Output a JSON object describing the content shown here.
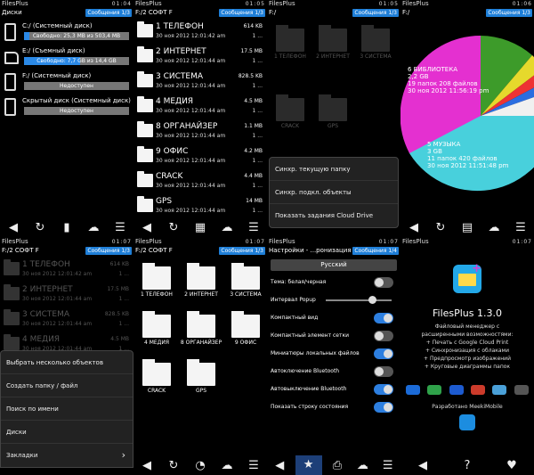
{
  "p1": {
    "status_left": "FilesPlus",
    "status_time": "01:04",
    "title": "Диски",
    "notif": "Сообщения 1/3",
    "drives": [
      {
        "name": "C:/ (Системный диск)",
        "bar": "Свободно: 25,3 MB из 503,4 MB",
        "fill": 0.05,
        "type": "phone"
      },
      {
        "name": "E:/ (Съемный диск)",
        "bar": "Свободно: 7,7 GB из 14,4 GB",
        "fill": 0.53,
        "type": "sd"
      },
      {
        "name": "F:/ (Системный диск)",
        "bar": "Недоступен",
        "fill": 0,
        "type": "phone"
      },
      {
        "name": "Скрытый диск (Системный диск)",
        "bar": "Недоступен",
        "fill": 0,
        "type": "phone"
      }
    ]
  },
  "p2": {
    "status_left": "FilesPlus",
    "status_time": "01:05",
    "title": "F:/2 СОФТ F",
    "notif": "Сообщения 1/3",
    "files": [
      {
        "name": "1 ТЕЛЕФОН",
        "size": "614 KB",
        "date": "30 ноя 2012 12:01:42 am",
        "size2": "1 ..."
      },
      {
        "name": "2 ИНТЕРНЕТ",
        "size": "17.5 MB",
        "date": "30 ноя 2012 12:01:44 am",
        "size2": "1 ..."
      },
      {
        "name": "3 СИСТЕМА",
        "size": "828.5 KB",
        "date": "30 ноя 2012 12:01:44 am",
        "size2": "1 ..."
      },
      {
        "name": "4 МЕДИЯ",
        "size": "4.5 MB",
        "date": "30 ноя 2012 12:01:44 am",
        "size2": "1 ..."
      },
      {
        "name": "8 ОРГАНАЙЗЕР",
        "size": "1.1 MB",
        "date": "30 ноя 2012 12:01:44 am",
        "size2": "1 ..."
      },
      {
        "name": "9 ОФИС",
        "size": "4.2 MB",
        "date": "30 ноя 2012 12:01:44 am",
        "size2": "1 ..."
      },
      {
        "name": "CRACK",
        "size": "4.4 MB",
        "date": "30 ноя 2012 12:01:44 am",
        "size2": "1 ..."
      },
      {
        "name": "GPS",
        "size": "14 MB",
        "date": "30 ноя 2012 12:01:44 am",
        "size2": "1 ..."
      }
    ]
  },
  "p3": {
    "status_left": "FilesPlus",
    "status_time": "01:05",
    "title": "F:/",
    "notif": "Сообщения 1/3",
    "folders": [
      "1 ТЕЛЕФОН",
      "2 ИНТЕРНЕТ",
      "3 СИСТЕМА",
      "CRACK",
      "GPS"
    ],
    "menu": [
      "Синхр. текущую папку",
      "Синхр. подкл. объекты",
      "Показать задания Cloud Drive"
    ]
  },
  "p4": {
    "status_left": "FilesPlus",
    "status_time": "01:06",
    "title": "F:/",
    "notif": "Сообщения 1/3",
    "lib": [
      "6 БИБЛИОТЕКА",
      "2,2 GB",
      "19 папок 208 файлов",
      "30 ноя 2012 11:56:19 pm"
    ],
    "music": [
      "5 МУЗЫКА",
      "3 GB",
      "11 папок 420 файлов",
      "30 ноя 2012 11:51:48 pm"
    ]
  },
  "p5": {
    "status_left": "FilesPlus",
    "status_time": "01:07",
    "title": "F:/2 СОФТ F",
    "notif": "Сообщения 1/3",
    "files": [
      {
        "name": "1 ТЕЛЕФОН",
        "size": "614 KB",
        "date": "30 ноя 2012 12:01:42 am",
        "size2": "1 ..."
      },
      {
        "name": "2 ИНТЕРНЕТ",
        "size": "17.5 MB",
        "date": "30 ноя 2012 12:01:44 am",
        "size2": "1 ..."
      },
      {
        "name": "3 СИСТЕМА",
        "size": "828.5 KB",
        "date": "30 ноя 2012 12:01:44 am",
        "size2": "1 ..."
      },
      {
        "name": "4 МЕДИЯ",
        "size": "4.5 MB",
        "date": "30 ноя 2012 12:01:44 am",
        "size2": "1 ..."
      }
    ],
    "menu": [
      "Выбрать несколько объектов",
      "Создать папку / файл",
      "Поиск по имени",
      "Диски",
      "Закладки"
    ]
  },
  "p6": {
    "status_left": "FilesPlus",
    "status_time": "01:07",
    "title": "F:/2 СОФТ F",
    "notif": "Сообщения 1/3",
    "folders": [
      "1 ТЕЛЕФОН",
      "2 ИНТЕРНЕТ",
      "3 СИСТЕМА",
      "4 МЕДИЯ",
      "8 ОРГАНАЙЗЕР",
      "9 ОФИС",
      "CRACK",
      "GPS"
    ]
  },
  "p7": {
    "status_left": "FilesPlus",
    "status_time": "01:07",
    "title": "Настройки - ...ронизация",
    "notif": "Сообщения 1/4",
    "lang": "Русский",
    "rows": [
      {
        "label": "Тема: белая/черная",
        "on": false
      },
      {
        "label": "Интервал Popup",
        "slider": true
      },
      {
        "label": "Компактный вид",
        "on": true
      },
      {
        "label": "Компактный элемент сетки",
        "on": false
      },
      {
        "label": "Миниатюры локальных файлов",
        "on": true
      },
      {
        "label": "Автоключение Bluetooth",
        "on": false
      },
      {
        "label": "Автовыключение Bluetooth",
        "on": true
      },
      {
        "label": "Показать строку состояния",
        "on": true
      }
    ]
  },
  "p8": {
    "status_left": "FilesPlus",
    "status_time": "01:07",
    "appname": "FilesPlus 1.3.0",
    "lines": [
      "Файловый менеджер с",
      "расширенными возможностями:",
      "+ Печать с Google Cloud Print",
      "+ Синхронизация с облаками",
      "+ Предпросмотр изображений",
      "+ Круговые диаграммы папок"
    ],
    "credit": "Разработано MeekiMobile",
    "cloud_colors": [
      "#1b6bd8",
      "#2fa24a",
      "#1d5bd0",
      "#cc3b2b",
      "#4aa0d8",
      "#555555"
    ]
  }
}
